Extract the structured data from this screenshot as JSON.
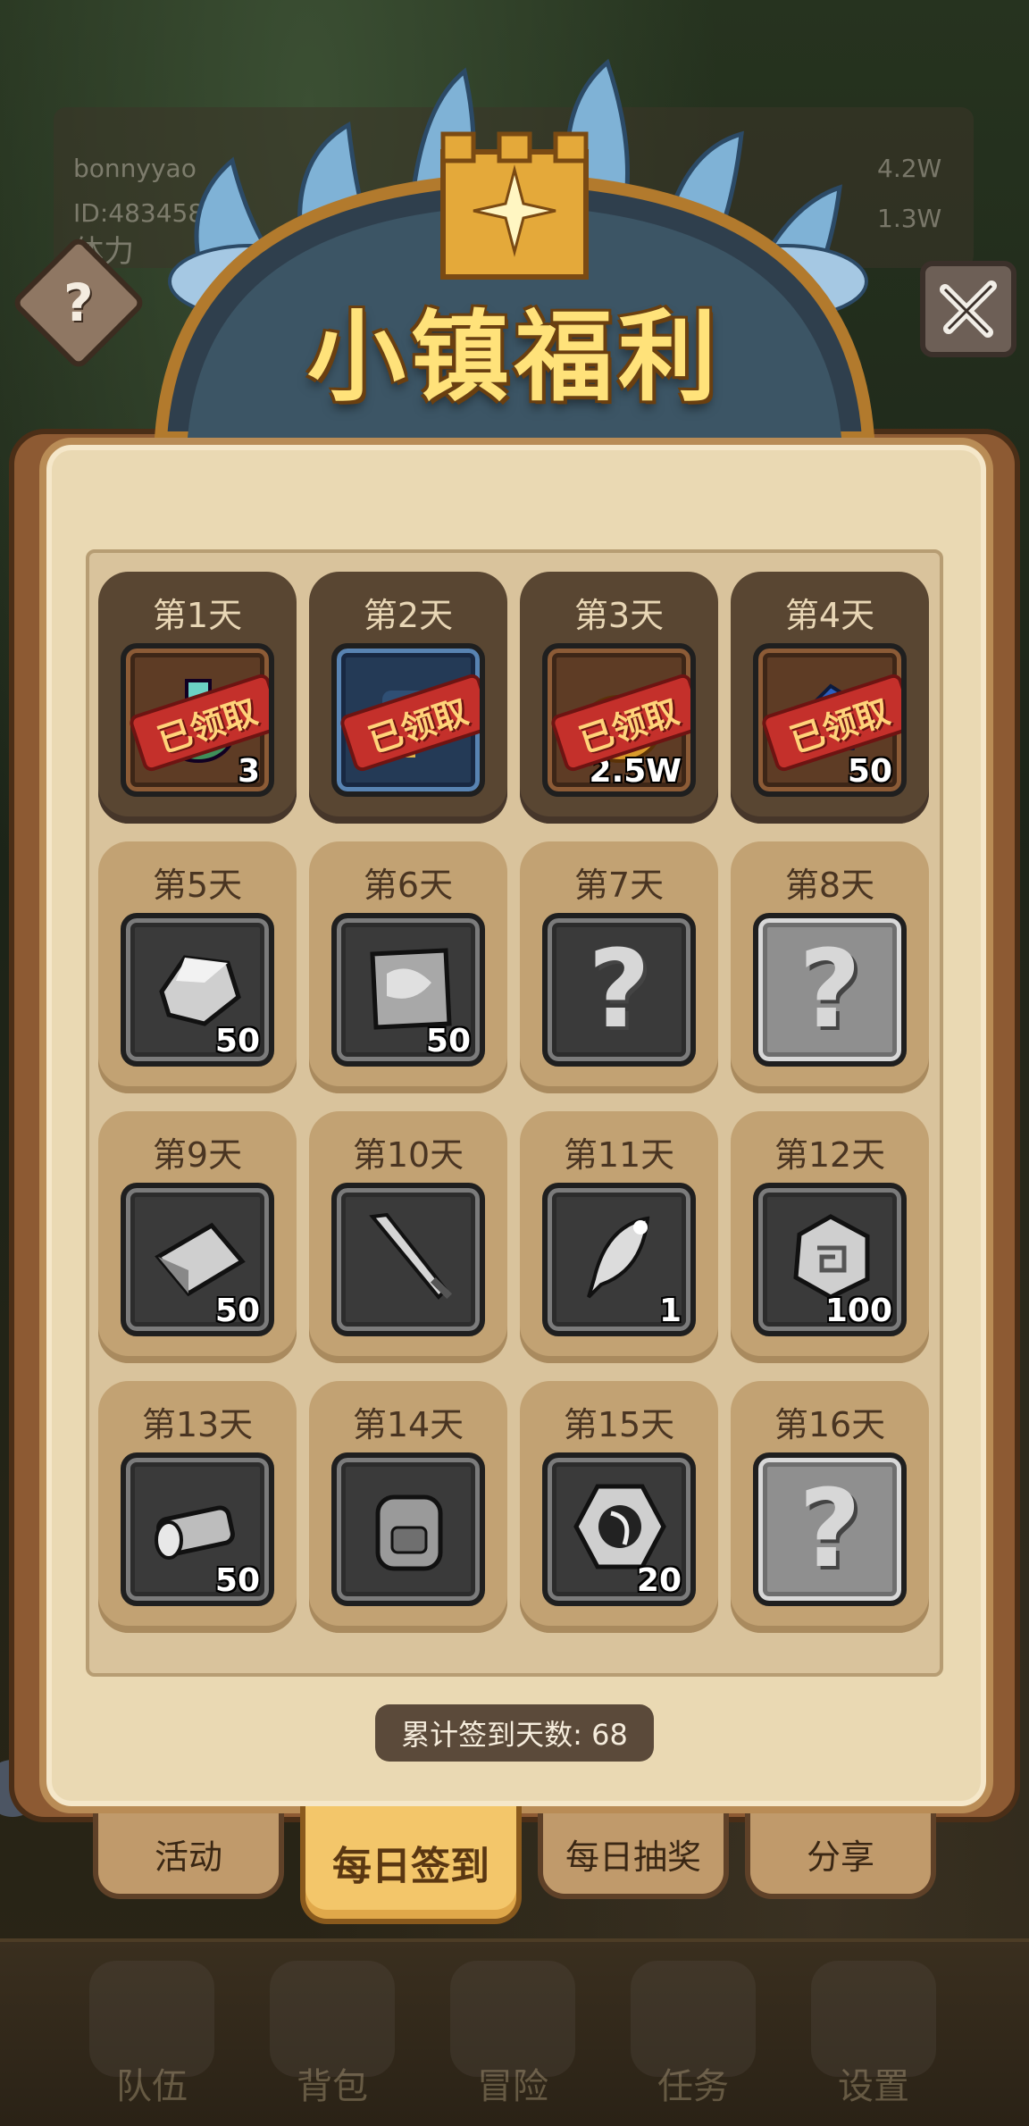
{
  "background": {
    "username": "bonnyyao",
    "user_id": "ID:483458",
    "stamina_label": "体力",
    "resource_1": "4.2W",
    "resource_2": "1.3W",
    "nav": [
      "队伍",
      "背包",
      "冒险",
      "任务",
      "设置"
    ]
  },
  "header": {
    "title": "小镇福利",
    "help_symbol": "?"
  },
  "days": [
    {
      "label": "第1天",
      "status": "claimed",
      "stamp": "已领取",
      "qty": "3",
      "icon": "potion-icon",
      "slot": "brown"
    },
    {
      "label": "第2天",
      "status": "claimed",
      "stamp": "已领取",
      "qty": "",
      "icon": "scroll-icon",
      "slot": "blue"
    },
    {
      "label": "第3天",
      "status": "claimed",
      "stamp": "已领取",
      "qty": "2.5W",
      "icon": "coin-bag-icon",
      "slot": "brown"
    },
    {
      "label": "第4天",
      "status": "claimed",
      "stamp": "已领取",
      "qty": "50",
      "icon": "blue-crystal-icon",
      "slot": "brown"
    },
    {
      "label": "第5天",
      "status": "locked",
      "qty": "50",
      "icon": "ore-icon",
      "slot": "gray"
    },
    {
      "label": "第6天",
      "status": "locked",
      "qty": "50",
      "icon": "cloth-icon",
      "slot": "gray"
    },
    {
      "label": "第7天",
      "status": "locked",
      "qty": "",
      "icon": "mystery-icon",
      "slot": "gray",
      "question": "?"
    },
    {
      "label": "第8天",
      "status": "locked",
      "qty": "",
      "icon": "mystery-icon",
      "slot": "silver",
      "question": "?"
    },
    {
      "label": "第9天",
      "status": "locked",
      "qty": "50",
      "icon": "ingot-icon",
      "slot": "gray"
    },
    {
      "label": "第10天",
      "status": "locked",
      "qty": "",
      "icon": "sword-icon",
      "slot": "gray"
    },
    {
      "label": "第11天",
      "status": "locked",
      "qty": "1",
      "icon": "feather-icon",
      "slot": "gray"
    },
    {
      "label": "第12天",
      "status": "locked",
      "qty": "100",
      "icon": "rune-stone-icon",
      "slot": "gray"
    },
    {
      "label": "第13天",
      "status": "locked",
      "qty": "50",
      "icon": "log-icon",
      "slot": "gray"
    },
    {
      "label": "第14天",
      "status": "locked",
      "qty": "",
      "icon": "backpack-icon",
      "slot": "gray"
    },
    {
      "label": "第15天",
      "status": "locked",
      "qty": "20",
      "icon": "emblem-icon",
      "slot": "gray"
    },
    {
      "label": "第16天",
      "status": "locked",
      "qty": "",
      "icon": "mystery-icon",
      "slot": "silver",
      "question": "?"
    }
  ],
  "total_checkin": "累计签到天数: 68",
  "tabs": [
    {
      "label": "活动",
      "active": false
    },
    {
      "label": "每日签到",
      "active": true
    },
    {
      "label": "每日抽奖",
      "active": false
    },
    {
      "label": "分享",
      "active": false
    }
  ],
  "colors": {
    "panel": "#ead9b3",
    "title": "#ffe27a",
    "stamp": "#c4302b",
    "active_tab": "#f3c66a"
  }
}
